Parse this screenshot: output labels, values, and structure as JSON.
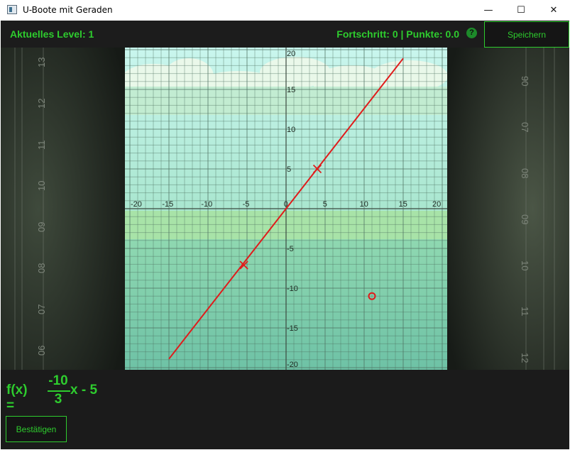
{
  "window": {
    "title": "U-Boote mit Geraden",
    "controls": {
      "minimize": "—",
      "maximize": "☐",
      "close": "✕"
    }
  },
  "header": {
    "level_text": "Aktuelles Level: 1",
    "progress_text": "Fortschritt: 0 | Punkte: 0.0",
    "help_label": "?",
    "save_label": "Speichern"
  },
  "scope": {
    "left_ticks": [
      "13",
      "12",
      "11",
      "10",
      "09",
      "08",
      "07",
      "06"
    ],
    "right_ticks": [
      "90",
      "07",
      "08",
      "09",
      "10",
      "11",
      "12"
    ]
  },
  "graph": {
    "x_ticks": [
      "-20",
      "-15",
      "-10",
      "-5",
      "0",
      "5",
      "10",
      "15",
      "20"
    ],
    "y_ticks": [
      "20",
      "15",
      "10",
      "5",
      "-5",
      "-10",
      "-15",
      "-20"
    ]
  },
  "chart_data": {
    "type": "scatter",
    "xlim": [
      -20,
      20
    ],
    "ylim": [
      -20,
      20
    ],
    "grid": true,
    "line": {
      "slope": 1.26,
      "intercept": 0,
      "color": "#e01b1b"
    },
    "cross_markers": [
      {
        "x": 4,
        "y": 5
      },
      {
        "x": -5.4,
        "y": -7.1
      }
    ],
    "target": {
      "x": 11,
      "y": -11,
      "color": "#e01b1b"
    }
  },
  "formula": {
    "prefix": "f(x) =",
    "numerator": "-10",
    "denominator": "3",
    "suffix": "x - 5",
    "color": "#2ecc2e"
  },
  "footer": {
    "confirm_label": "Bestätigen"
  },
  "colors": {
    "accent": "#2ecc2e",
    "background": "#1b1b1b",
    "line": "#e01b1b"
  }
}
